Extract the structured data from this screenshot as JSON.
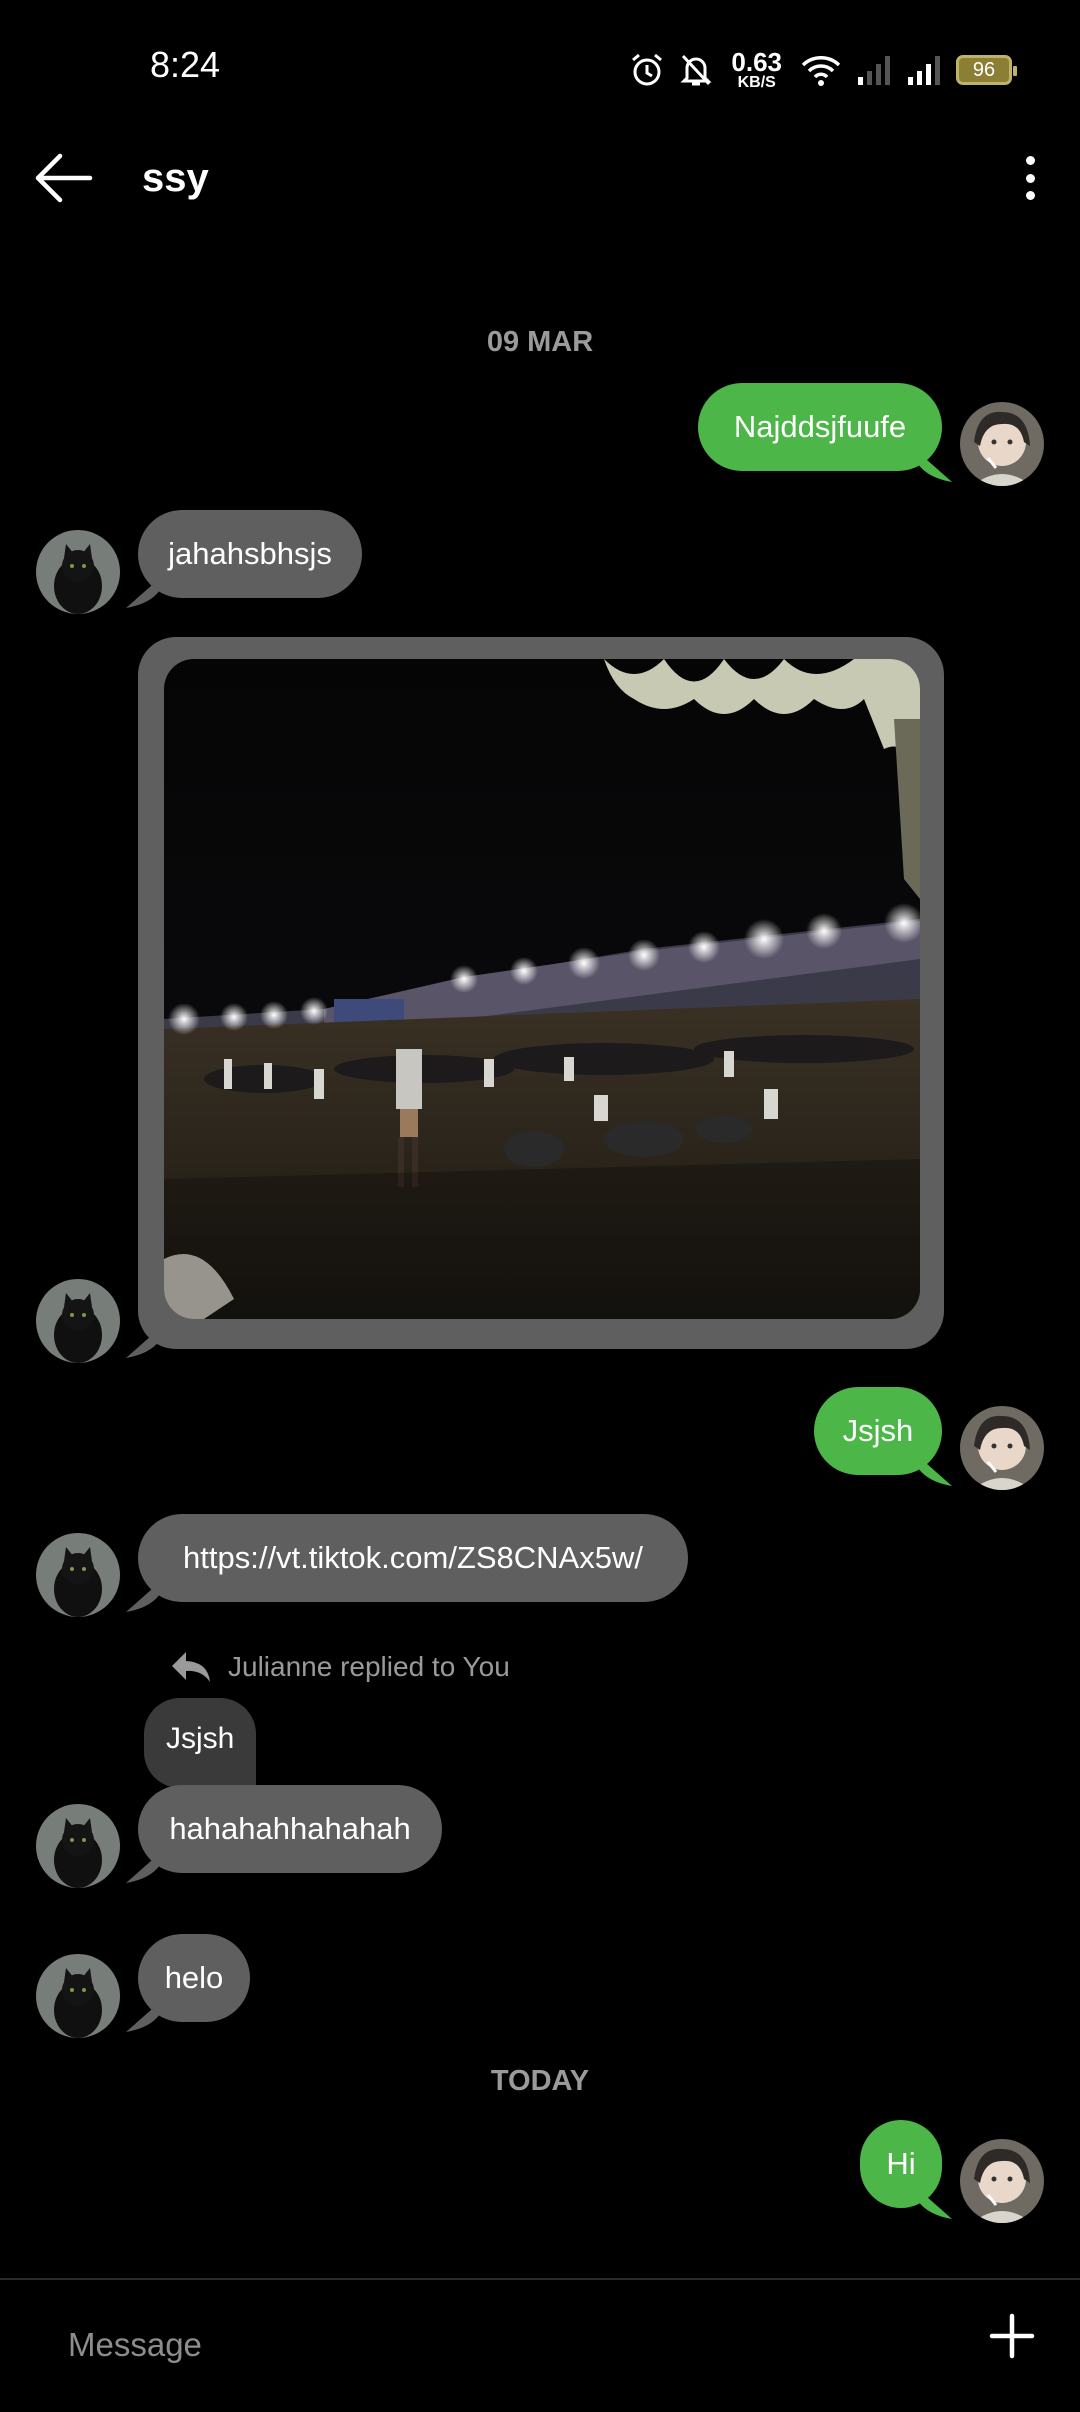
{
  "status_bar": {
    "time": "8:24",
    "net_speed_value": "0.63",
    "net_speed_unit": "KB/S",
    "battery": "96",
    "icons": [
      "alarm-icon",
      "bell-off-icon",
      "wifi-icon",
      "signal-icon",
      "signal-icon",
      "battery-icon"
    ]
  },
  "header": {
    "title": "ssy",
    "back_icon": "arrow-left-icon",
    "menu_icon": "more-vertical-icon"
  },
  "dividers": {
    "first": "09 MAR",
    "second": "TODAY"
  },
  "messages": {
    "m1": "Najddsjfuufe",
    "m2": "jahahsbhsjs",
    "m4": "Jsjsh",
    "m5": "https://vt.tiktok.com/ZS8CNAx5w/",
    "reply_context": "Julianne replied to You",
    "quoted": "Jsjsh",
    "m6": "hahahahhahahah",
    "m7": "helo",
    "m8": "Hi"
  },
  "composer": {
    "placeholder": "Message",
    "add_icon": "plus-icon"
  },
  "colors": {
    "outgoing": "#4cb648",
    "incoming": "#5f5f5f",
    "background": "#000000"
  }
}
